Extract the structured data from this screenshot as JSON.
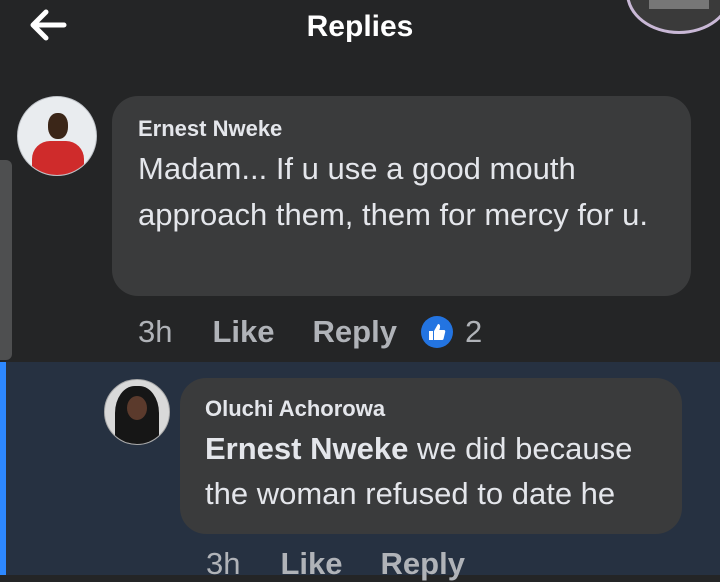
{
  "header": {
    "title": "Replies",
    "back_icon": "arrow-left-icon"
  },
  "comments": [
    {
      "author": "Ernest Nweke",
      "text": "Madam... If u use a good mouth approach them, them for mercy for u.",
      "time": "3h",
      "like_label": "Like",
      "reply_label": "Reply",
      "reaction_icon": "thumbs-up-icon",
      "reaction_count": "2"
    },
    {
      "author": "Oluchi Achorowa",
      "mention": "Ernest Nweke",
      "text": " we did because the woman refused to date he",
      "time": "3h",
      "like_label": "Like",
      "reply_label": "Reply"
    }
  ],
  "colors": {
    "background": "#242526",
    "bubble": "#3a3b3c",
    "highlight": "#263141",
    "accent": "#2d88ff",
    "muted_text": "#b0b3b8"
  }
}
